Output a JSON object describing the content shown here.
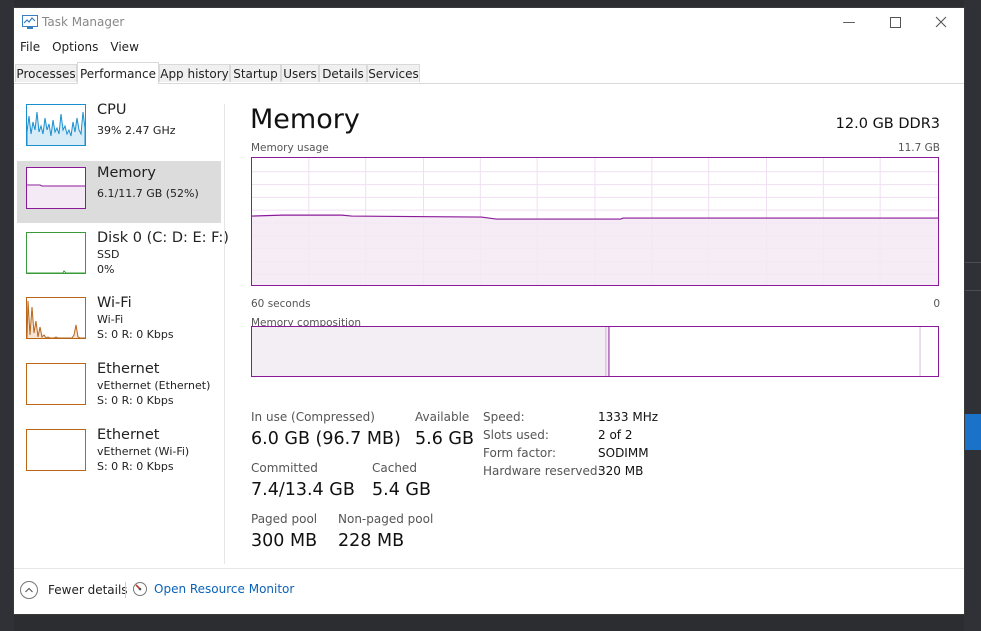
{
  "window": {
    "title": "Task Manager"
  },
  "menu": [
    "File",
    "Options",
    "View"
  ],
  "tabs": [
    "Processes",
    "Performance",
    "App history",
    "Startup",
    "Users",
    "Details",
    "Services"
  ],
  "sidebar": {
    "items": [
      {
        "name": "CPU",
        "sub1": "39%  2.47 GHz",
        "sub2": "",
        "color": "#1a8fcf"
      },
      {
        "name": "Memory",
        "sub1": "6.1/11.7 GB (52%)",
        "sub2": "",
        "color": "#8b1a9a"
      },
      {
        "name": "Disk 0 (C: D: E: F:)",
        "sub1": "SSD",
        "sub2": "0%",
        "color": "#3a9b3a"
      },
      {
        "name": "Wi-Fi",
        "sub1": "Wi-Fi",
        "sub2": "S: 0  R: 0 Kbps",
        "color": "#b8651a"
      },
      {
        "name": "Ethernet",
        "sub1": "vEthernet (Ethernet)",
        "sub2": "S: 0  R: 0 Kbps",
        "color": "#b8651a"
      },
      {
        "name": "Ethernet",
        "sub1": "vEthernet (Wi-Fi)",
        "sub2": "S: 0  R: 0 Kbps",
        "color": "#b8651a"
      }
    ]
  },
  "main": {
    "title": "Memory",
    "type": "12.0 GB DDR3",
    "usage_label": "Memory usage",
    "usage_max": "11.7 GB",
    "time_label": "60 seconds",
    "time_zero": "0",
    "composition_label": "Memory composition",
    "accent": "#8b1a9a",
    "stats": {
      "in_use_label": "In use (Compressed)",
      "in_use_value": "6.0 GB (96.7 MB)",
      "available_label": "Available",
      "available_value": "5.6 GB",
      "committed_label": "Committed",
      "committed_value": "7.4/13.4 GB",
      "cached_label": "Cached",
      "cached_value": "5.4 GB",
      "paged_label": "Paged pool",
      "paged_value": "300 MB",
      "nonpaged_label": "Non-paged pool",
      "nonpaged_value": "228 MB"
    },
    "specs": [
      {
        "label": "Speed:",
        "value": "1333 MHz"
      },
      {
        "label": "Slots used:",
        "value": "2 of 2"
      },
      {
        "label": "Form factor:",
        "value": "SODIMM"
      },
      {
        "label": "Hardware reserved:",
        "value": "320 MB"
      }
    ]
  },
  "footer": {
    "fewer": "Fewer details",
    "resource_monitor": "Open Resource Monitor"
  }
}
